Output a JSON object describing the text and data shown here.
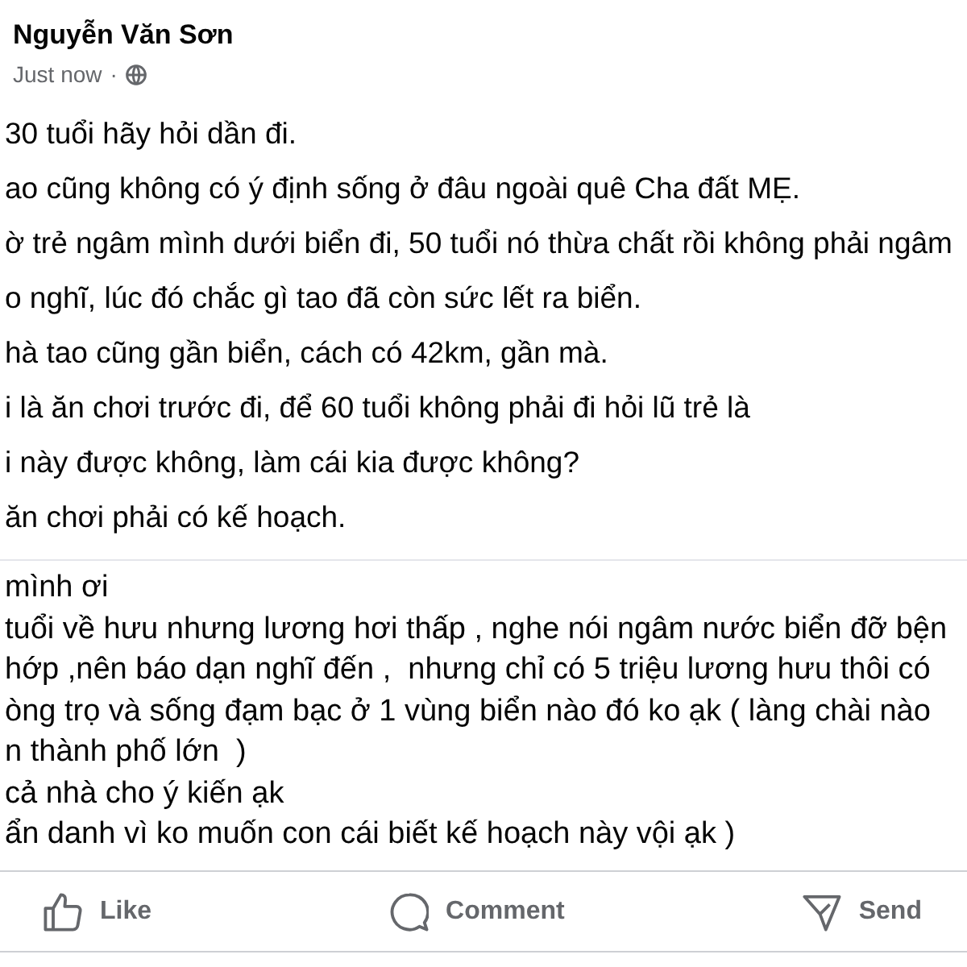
{
  "post": {
    "author": "Nguyễn Văn Sơn",
    "timestamp": "Just now",
    "separator": "·"
  },
  "paragraphs": [
    "30 tuổi hãy hỏi dần đi.",
    "ao cũng không có ý định sống ở đâu ngoài quê Cha đất MẸ.",
    "ờ trẻ ngâm mình dưới biển đi, 50 tuổi nó thừa chất rồi không phải ngâm",
    "o nghĩ, lúc đó chắc gì tao đã còn sức lết ra biển.",
    "hà tao cũng gần biển, cách có 42km, gần mà.",
    "i là ăn chơi trước đi, để 60 tuổi không phải đi hỏi lũ trẻ là",
    "i này được không, làm cái kia được không?",
    "ăn chơi phải có kế hoạch."
  ],
  "quoted_text": [
    "mình ơi",
    "tuổi về hưu nhưng lương hơi thấp , nghe nói ngâm nước biển đỡ bện",
    "hớp ,nên báo dạn nghĩ đến ,  nhưng chỉ có 5 triệu lương hưu thôi có",
    "òng trọ và sống đạm bạc ở 1 vùng biển nào đó ko ạk ( làng chài nào",
    "n thành phố lớn  )",
    "cả nhà cho ý kiến ạk",
    "ẩn danh vì ko muốn con cái biết kế hoạch này vội ạk )"
  ],
  "actions": [
    {
      "label": "Like",
      "kind": "like"
    },
    {
      "label": "Comment",
      "kind": "comment"
    },
    {
      "label": "Send",
      "kind": "send"
    }
  ]
}
